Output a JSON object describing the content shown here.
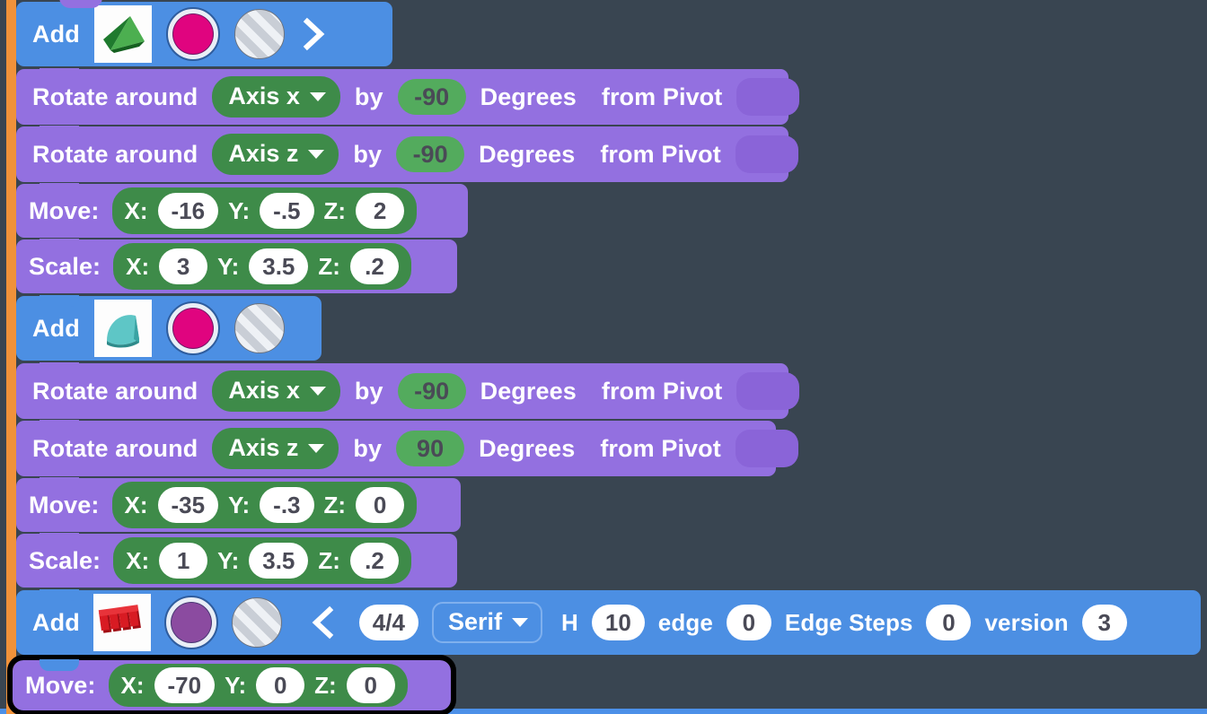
{
  "app": {
    "background_color": "#394551",
    "rail_color": "#f0923a",
    "block_colors": {
      "add": "#4c8fe3",
      "transform": "#9370e0",
      "field": "#3e8b49"
    }
  },
  "blocks": [
    {
      "id": "add-pyramid",
      "type": "add",
      "label": "Add",
      "thumbnail": "green-pyramid-3d-shape",
      "color_swatch": "#e0047f",
      "material_swatch": "striped-gray",
      "chevron": "chevron-right-icon"
    },
    {
      "id": "rotate-1",
      "type": "rotate",
      "prefix": "Rotate around",
      "axis": "Axis x",
      "by": "by",
      "degrees": "-90",
      "unit": "Degrees",
      "pivot_label": "from Pivot"
    },
    {
      "id": "rotate-2",
      "type": "rotate",
      "prefix": "Rotate around",
      "axis": "Axis z",
      "by": "by",
      "degrees": "-90",
      "unit": "Degrees",
      "pivot_label": "from Pivot"
    },
    {
      "id": "move-1",
      "type": "move",
      "label": "Move:",
      "x_key": "X:",
      "x": "-16",
      "y_key": "Y:",
      "y": "-.5",
      "z_key": "Z:",
      "z": "2"
    },
    {
      "id": "scale-1",
      "type": "scale",
      "label": "Scale:",
      "x_key": "X:",
      "x": "3",
      "y_key": "Y:",
      "y": "3.5",
      "z_key": "Z:",
      "z": ".2"
    },
    {
      "id": "add-dome",
      "type": "add",
      "label": "Add",
      "thumbnail": "teal-dome-3d-shape",
      "color_swatch": "#e0047f",
      "material_swatch": "striped-gray",
      "chevron": null
    },
    {
      "id": "rotate-3",
      "type": "rotate",
      "prefix": "Rotate around",
      "axis": "Axis x",
      "by": "by",
      "degrees": "-90",
      "unit": "Degrees",
      "pivot_label": "from Pivot"
    },
    {
      "id": "rotate-4",
      "type": "rotate",
      "prefix": "Rotate around",
      "axis": "Axis z",
      "by": "by",
      "degrees": "90",
      "unit": "Degrees",
      "pivot_label": "from Pivot"
    },
    {
      "id": "move-2",
      "type": "move",
      "label": "Move:",
      "x_key": "X:",
      "x": "-35",
      "y_key": "Y:",
      "y": "-.3",
      "z_key": "Z:",
      "z": "0"
    },
    {
      "id": "scale-2",
      "type": "scale",
      "label": "Scale:",
      "x_key": "X:",
      "x": "1",
      "y_key": "Y:",
      "y": "3.5",
      "z_key": "Z:",
      "z": ".2"
    },
    {
      "id": "add-text",
      "type": "add-text",
      "label": "Add",
      "thumbnail": "red-3d-text-shape",
      "color_swatch": "#8b4ba0",
      "material_swatch": "striped-gray",
      "chevron": "chevron-left-icon",
      "page": "4/4",
      "font": "Serif",
      "h_key": "H",
      "h_value": "10",
      "edge_key": "edge",
      "edge_value": "0",
      "edge_steps_key": "Edge Steps",
      "edge_steps_value": "0",
      "version_key": "version",
      "version_value": "3"
    },
    {
      "id": "move-3",
      "type": "move",
      "label": "Move:",
      "x_key": "X:",
      "x": "-70",
      "y_key": "Y:",
      "y": "0",
      "z_key": "Z:",
      "z": "0",
      "selected": true
    }
  ]
}
